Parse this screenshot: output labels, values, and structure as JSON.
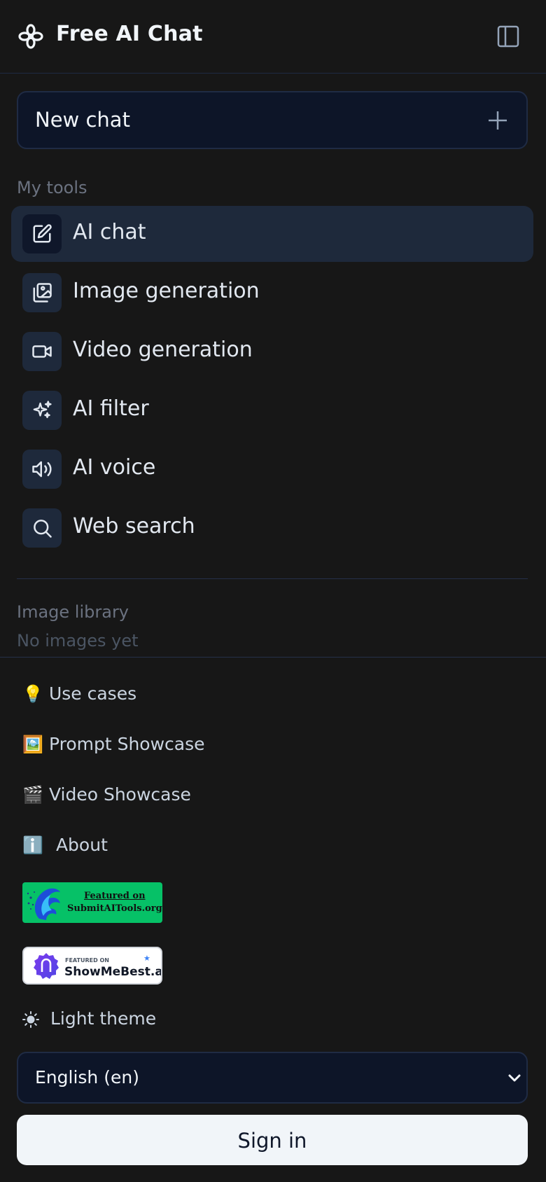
{
  "header": {
    "title": "Free AI Chat"
  },
  "new_chat": {
    "label": "New chat"
  },
  "tools": {
    "heading": "My tools",
    "items": [
      {
        "label": "AI chat",
        "icon": "edit-icon",
        "active": true
      },
      {
        "label": "Image generation",
        "icon": "image-icon"
      },
      {
        "label": "Video generation",
        "icon": "video-camera-icon"
      },
      {
        "label": "AI filter",
        "icon": "sparkles-icon"
      },
      {
        "label": "AI voice",
        "icon": "speaker-icon"
      },
      {
        "label": "Web search",
        "icon": "search-icon"
      }
    ]
  },
  "library": {
    "heading": "Image library",
    "empty": "No images yet"
  },
  "links": [
    {
      "emoji": "💡",
      "label": "Use cases"
    },
    {
      "emoji": "🖼️",
      "label": "Prompt Showcase"
    },
    {
      "emoji": "🎬",
      "label": "Video Showcase"
    },
    {
      "emoji": "ℹ️",
      "label": "About"
    }
  ],
  "badges": {
    "submit": {
      "line1": "Featured on",
      "line2": "SubmitAITools.org"
    },
    "showme": {
      "line1": "FEATURED ON",
      "line2": "ShowMeBest.ai"
    }
  },
  "theme": {
    "label": "Light theme"
  },
  "language": {
    "selected": "English (en)"
  },
  "auth": {
    "sign_in": "Sign in"
  },
  "colors": {
    "background": "#171717",
    "panel": "#0d1528",
    "active": "#1e293b",
    "badge_green": "#06c167"
  }
}
